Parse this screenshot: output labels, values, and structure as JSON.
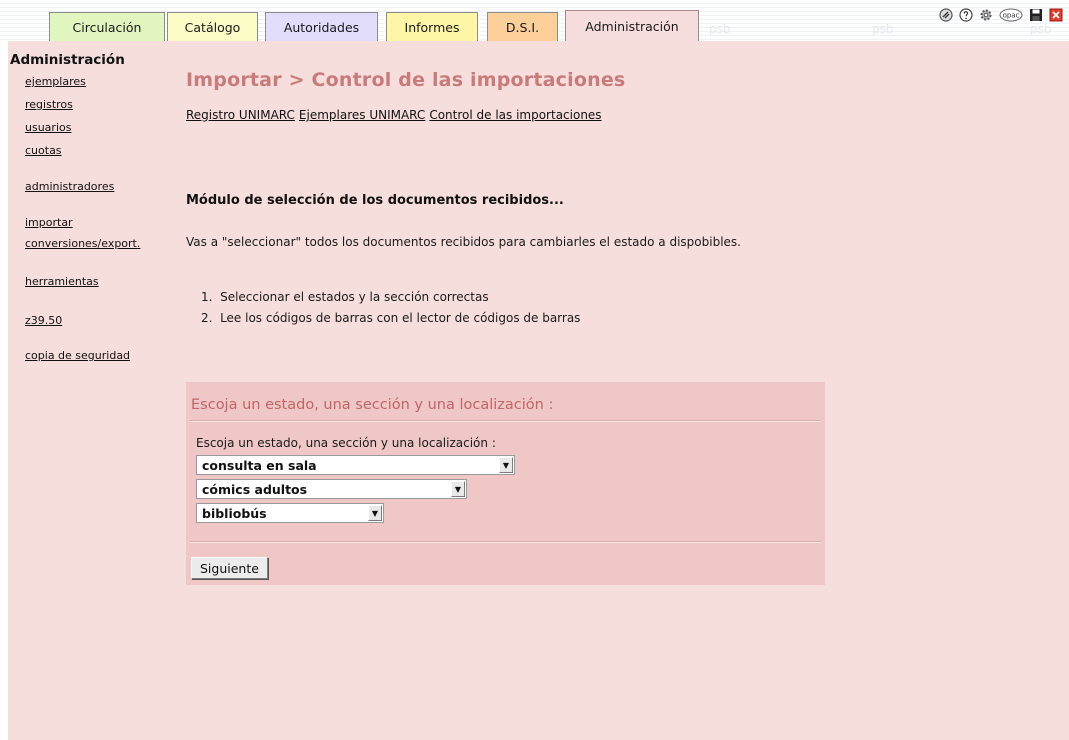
{
  "tabs": [
    {
      "label": "Circulación",
      "color": "#e1f5bf"
    },
    {
      "label": "Catálogo",
      "color": "#fcfcc7"
    },
    {
      "label": "Autoridades",
      "color": "#e2ddfb"
    },
    {
      "label": "Informes",
      "color": "#fdf6a6"
    },
    {
      "label": "D.S.I.",
      "color": "#fdd09a"
    },
    {
      "label": "Administración",
      "color": "#f7dede"
    }
  ],
  "watermark": "psb",
  "icons": [
    "tools-icon",
    "help-icon",
    "settings-icon",
    "opac-icon",
    "save-icon",
    "close-icon"
  ],
  "icon_opac_text": "opac",
  "menu": {
    "title": "Administración",
    "items": [
      "ejemplares",
      "registros",
      "usuarios",
      "cuotas",
      "administradores",
      "importar",
      "conversiones/export.",
      "herramientas",
      "z39.50",
      "copia de seguridad"
    ]
  },
  "page": {
    "title": "Importar > Control de las importaciones",
    "crumbs": [
      "Registro UNIMARC",
      "Ejemplares UNIMARC",
      "Control de las importaciones"
    ],
    "module_title": "Módulo de selección de los documentos recibidos...",
    "intro": "Vas a \"seleccionar\" todos los documentos recibidos para cambiarles el estado a dispobibles.",
    "steps": [
      "Seleccionar el estados y la sección correctas",
      "Lee los códigos de barras con el lector de códigos de barras"
    ]
  },
  "panel": {
    "title": "Escoja un estado, una sección y una localización :",
    "label": "Escoja un estado, una sección y una localización :",
    "selects": [
      "consulta en sala",
      "cómics adultos",
      "bibliobús"
    ],
    "button": "Siguiente"
  },
  "colors": {
    "background": "#f6dedd",
    "panel": "#efc7c7",
    "title": "#c97a7a"
  }
}
